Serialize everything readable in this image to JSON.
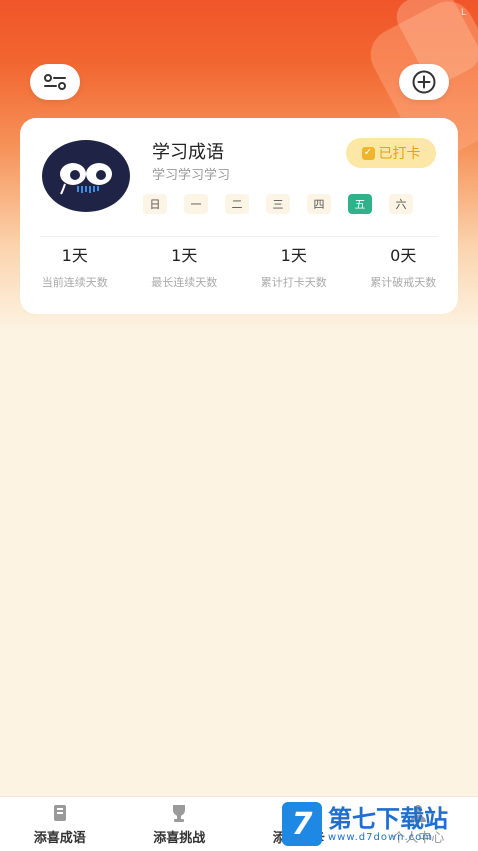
{
  "status_mark": "L",
  "habit": {
    "title": "学习成语",
    "subtitle": "学习学习学习",
    "status": "已打卡",
    "week": [
      "日",
      "一",
      "二",
      "三",
      "四",
      "五",
      "六"
    ],
    "active_day": "五"
  },
  "stats": [
    {
      "value": "1天",
      "label": "当前连续天数"
    },
    {
      "value": "1天",
      "label": "最长连续天数"
    },
    {
      "value": "1天",
      "label": "累计打卡天数"
    },
    {
      "value": "0天",
      "label": "累计破戒天数"
    }
  ],
  "tabs": [
    {
      "label": "添喜成语",
      "icon": "book-icon"
    },
    {
      "label": "添喜挑战",
      "icon": "trophy-icon"
    },
    {
      "label": "添喜打卡",
      "icon": "checkin-icon"
    },
    {
      "label": "个人中心",
      "icon": "user-icon"
    }
  ],
  "watermark": {
    "logo": "7",
    "name": "第七下载站",
    "url": "www.d7down.com"
  },
  "colors": {
    "accent": "#f0562a",
    "active_day": "#2fb28a",
    "badge_bg": "#fde7a6",
    "badge_text": "#e0a21a",
    "page_bg": "#fcf3e2"
  }
}
